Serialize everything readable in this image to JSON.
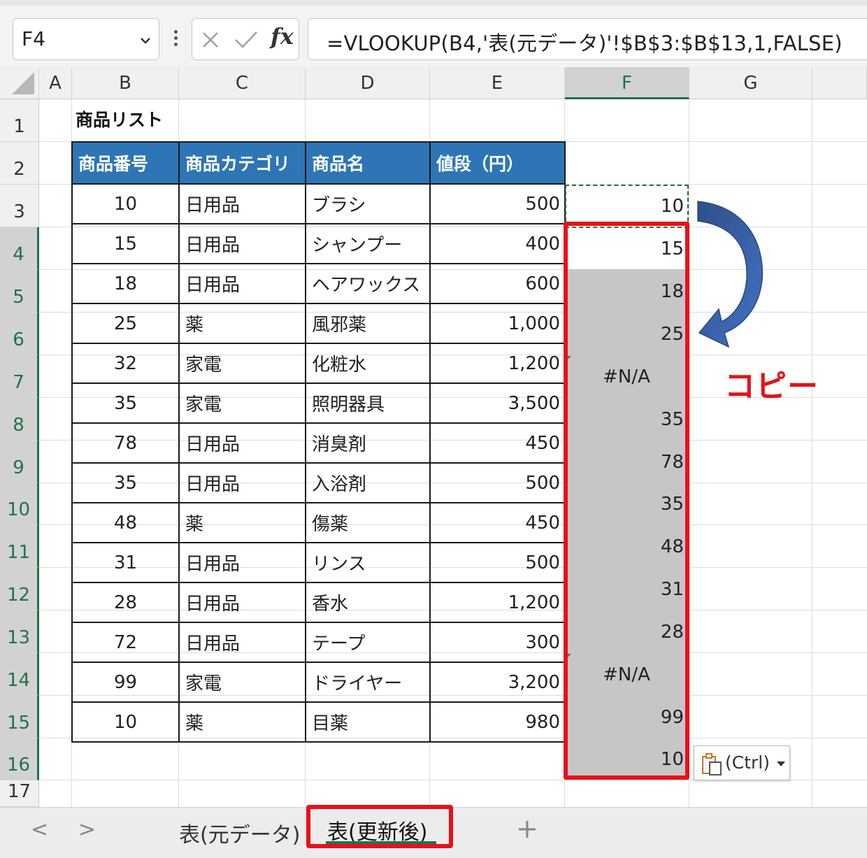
{
  "formula_bar": {
    "name_box": "F4",
    "fx_label": "fx",
    "formula": "=VLOOKUP(B4,'表(元データ)'!$B$3:$B$13,1,FALSE)"
  },
  "columns": [
    "A",
    "B",
    "C",
    "D",
    "E",
    "F",
    "G"
  ],
  "rows": [
    "1",
    "2",
    "3",
    "4",
    "5",
    "6",
    "7",
    "8",
    "9",
    "10",
    "11",
    "12",
    "13",
    "14",
    "15",
    "16",
    "17"
  ],
  "sheet_title": "商品リスト",
  "table": {
    "headers": [
      "商品番号",
      "商品カテゴリ",
      "商品名",
      "値段（円）"
    ],
    "rows": [
      [
        "10",
        "日用品",
        "ブラシ",
        "500"
      ],
      [
        "15",
        "日用品",
        "シャンプー",
        "400"
      ],
      [
        "18",
        "日用品",
        "ヘアワックス",
        "600"
      ],
      [
        "25",
        "薬",
        "風邪薬",
        "1,000"
      ],
      [
        "32",
        "家電",
        "化粧水",
        "1,200"
      ],
      [
        "35",
        "家電",
        "照明器具",
        "3,500"
      ],
      [
        "78",
        "日用品",
        "消臭剤",
        "450"
      ],
      [
        "35",
        "日用品",
        "入浴剤",
        "500"
      ],
      [
        "48",
        "薬",
        "傷薬",
        "450"
      ],
      [
        "31",
        "日用品",
        "リンス",
        "500"
      ],
      [
        "28",
        "日用品",
        "香水",
        "1,200"
      ],
      [
        "72",
        "日用品",
        "テープ",
        "300"
      ],
      [
        "99",
        "家電",
        "ドライヤー",
        "3,200"
      ],
      [
        "10",
        "薬",
        "目薬",
        "980"
      ]
    ]
  },
  "column_f": [
    "10",
    "15",
    "18",
    "25",
    "#N/A",
    "35",
    "78",
    "35",
    "48",
    "31",
    "28",
    "#N/A",
    "99",
    "10"
  ],
  "annotation": {
    "copy_label": "コピー",
    "color": "#e8101a"
  },
  "paste_options": {
    "label": "(Ctrl)"
  },
  "sheet_tabs": [
    {
      "label": "表(元データ)",
      "active": false
    },
    {
      "label": "表(更新後)",
      "active": true
    }
  ],
  "colors": {
    "header_blue": "#2e75b6",
    "excel_green": "#217346",
    "selection_gray": "#c6c6c6"
  }
}
